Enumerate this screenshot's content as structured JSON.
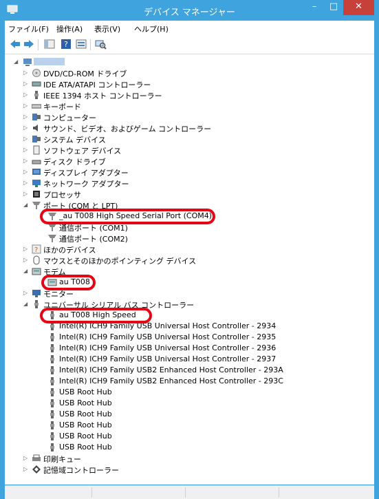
{
  "window": {
    "title": "デバイス マネージャー"
  },
  "menu": [
    "ファイル(F)",
    "操作(A)",
    "表示(V)",
    "ヘルプ(H)"
  ],
  "tree": {
    "root": "",
    "items": {
      "dvd": "DVD/CD-ROM ドライブ",
      "ide": "IDE ATA/ATAPI コントローラー",
      "ieee": "IEEE 1394 ホスト コントローラー",
      "keyboard": "キーボード",
      "computer": "コンピューター",
      "sound": "サウンド、ビデオ、およびゲーム コントローラー",
      "system": "システム デバイス",
      "software": "ソフトウェア デバイス",
      "disk": "ディスク ドライブ",
      "display": "ディスプレイ アダプター",
      "network": "ネットワーク アダプター",
      "processor": "プロセッサ",
      "ports": "ポート (COM と LPT)",
      "port_au": "_au T008 High Speed Serial Port  (COM4)",
      "port_com1": "通信ポート (COM1)",
      "port_com2": "通信ポート (COM2)",
      "other": "ほかのデバイス",
      "mouse": "マウスとそのほかのポインティング デバイス",
      "modem": "モデム",
      "modem_au": "au T008",
      "monitor": "モニター",
      "usb": "ユニバーサル シリアル バス コントローラー",
      "usb_au": "au T008 High Speed",
      "usb_2934": "Intel(R) ICH9 Family USB Universal Host Controller - 2934",
      "usb_2935": "Intel(R) ICH9 Family USB Universal Host Controller - 2935",
      "usb_2936": "Intel(R) ICH9 Family USB Universal Host Controller - 2936",
      "usb_2937": "Intel(R) ICH9 Family USB Universal Host Controller - 2937",
      "usb_293a": "Intel(R) ICH9 Family USB2 Enhanced Host Controller - 293A",
      "usb_293c": "Intel(R) ICH9 Family USB2 Enhanced Host Controller - 293C",
      "hub1": "USB Root Hub",
      "hub2": "USB Root Hub",
      "hub3": "USB Root Hub",
      "hub4": "USB Root Hub",
      "hub5": "USB Root Hub",
      "hub6": "USB Root Hub",
      "print": "印刷キュー",
      "storage": "記憶域コントローラー"
    }
  },
  "colors": {
    "titlebar": "#3fa3dd",
    "close": "#c7403a",
    "highlight": "#e30613"
  }
}
